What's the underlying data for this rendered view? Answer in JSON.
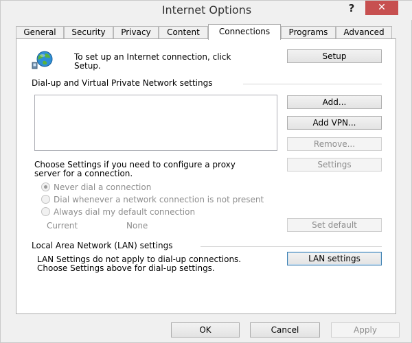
{
  "window": {
    "title": "Internet Options",
    "help": "?",
    "close": "✕"
  },
  "tabs": [
    {
      "label": "General"
    },
    {
      "label": "Security"
    },
    {
      "label": "Privacy"
    },
    {
      "label": "Content"
    },
    {
      "label": "Connections",
      "active": true
    },
    {
      "label": "Programs"
    },
    {
      "label": "Advanced"
    }
  ],
  "connections": {
    "setup_text_1": "To set up an Internet connection, click",
    "setup_text_2": "Setup.",
    "setup_button": "Setup",
    "dialup_section_title": "Dial-up and Virtual Private Network settings",
    "add_button": "Add...",
    "add_vpn_button": "Add VPN...",
    "remove_button": "Remove...",
    "proxy_text_1": "Choose Settings if you need to configure a proxy",
    "proxy_text_2": "server for a connection.",
    "settings_button": "Settings",
    "radio_never": "Never dial a connection",
    "radio_dial_when": "Dial whenever a network connection is not present",
    "radio_always": "Always dial my default connection",
    "current_label": "Current",
    "current_value": "None",
    "set_default_button": "Set default",
    "lan_section_title": "Local Area Network (LAN) settings",
    "lan_text_1": "LAN Settings do not apply to dial-up connections.",
    "lan_text_2": "Choose Settings above for dial-up settings.",
    "lan_settings_button": "LAN settings"
  },
  "footer": {
    "ok": "OK",
    "cancel": "Cancel",
    "apply": "Apply"
  },
  "icons": {
    "globe": "globe-network-icon"
  }
}
